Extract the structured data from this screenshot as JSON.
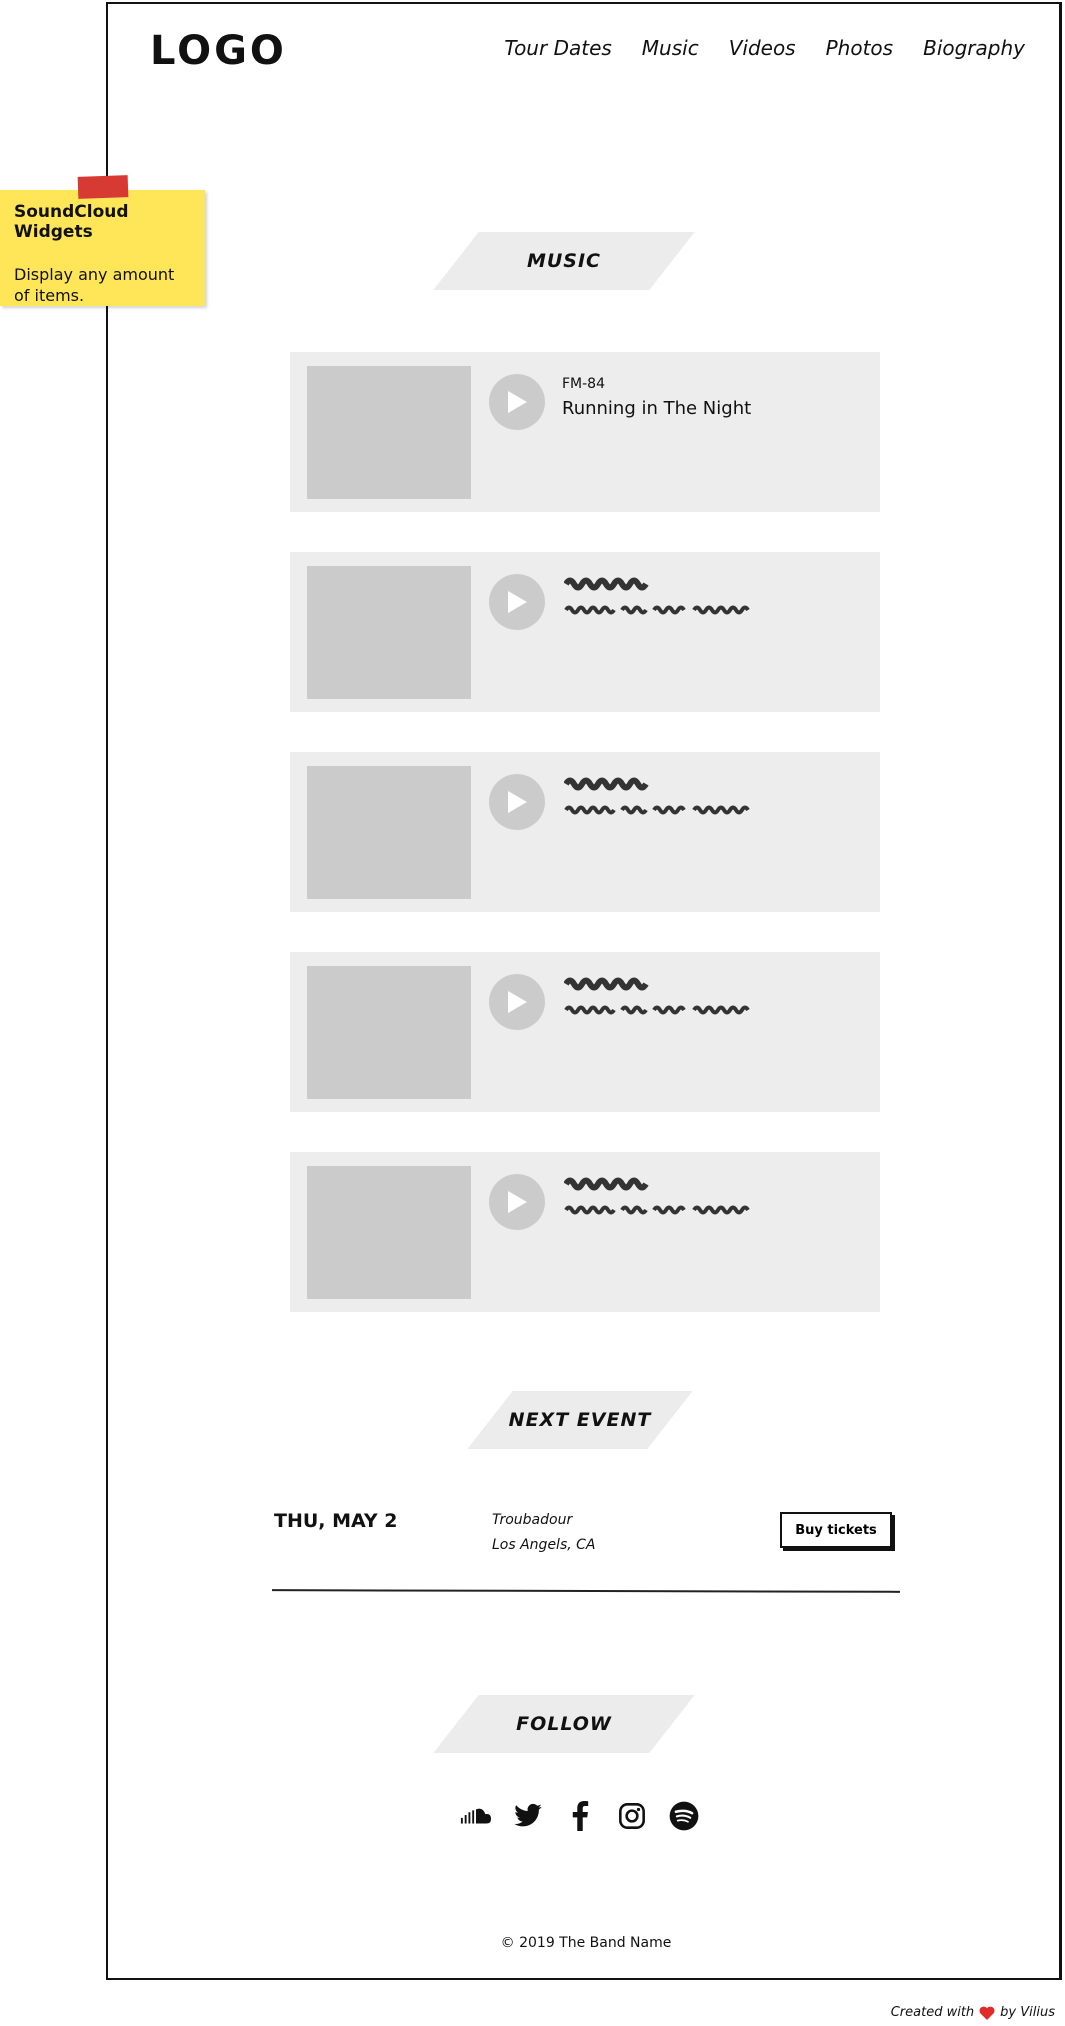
{
  "header": {
    "logo": "LOGO",
    "nav": [
      "Tour Dates",
      "Music",
      "Videos",
      "Photos",
      "Biography"
    ]
  },
  "note": {
    "title": "SoundCloud Widgets",
    "body": "Display any amount of items."
  },
  "music": {
    "heading": "MUSIC",
    "tracks": [
      {
        "artist": "FM-84",
        "title": "Running in The Night"
      }
    ]
  },
  "event": {
    "heading": "NEXT EVENT",
    "date": "THU, MAY 2",
    "venue": "Troubadour",
    "location": "Los Angels, CA",
    "button": "Buy tickets"
  },
  "follow": {
    "heading": "FOLLOW",
    "icons": [
      "soundcloud-icon",
      "twitter-icon",
      "facebook-icon",
      "instagram-icon",
      "spotify-icon"
    ]
  },
  "footer": {
    "copyright": "© 2019 The Band Name",
    "credit_prefix": "Created with",
    "credit_suffix": "by Vilius"
  },
  "colors": {
    "card": "#ededed",
    "placeholder": "#cbcbcb",
    "note": "#ffe659",
    "tape": "#d63a32",
    "heart": "#e02b2b"
  }
}
